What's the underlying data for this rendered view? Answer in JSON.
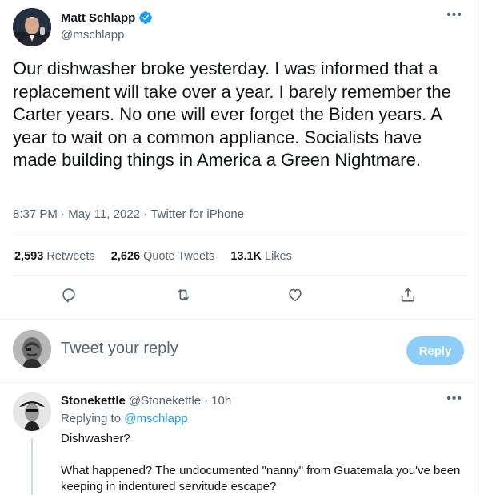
{
  "tweet": {
    "author": {
      "name": "Matt Schlapp",
      "handle": "@mschlapp",
      "verified": true,
      "avatar_icon": "person-photo"
    },
    "text": "Our dishwasher broke yesterday. I was informed that a replacement will take over a year. I barely remember the Carter years. No one will ever forget the Biden years. A year to wait on a common appliance. Socialists have made building things in America a Green Nightmare.",
    "time": "8:37 PM",
    "date": "May 11, 2022",
    "source": "Twitter for iPhone",
    "stats": [
      {
        "value": "2,593",
        "label": "Retweets"
      },
      {
        "value": "2,626",
        "label": "Quote Tweets"
      },
      {
        "value": "13.1K",
        "label": "Likes"
      }
    ],
    "actions": [
      "reply-icon",
      "retweet-icon",
      "like-icon",
      "share-icon"
    ]
  },
  "composer": {
    "placeholder": "Tweet your reply",
    "button_label": "Reply"
  },
  "reply": {
    "name": "Stonekettle",
    "handle": "@Stonekettle",
    "dot": "·",
    "time": "10h",
    "replying_prefix": "Replying to ",
    "replying_to": "@mschlapp",
    "paragraphs": [
      "Dishwasher?",
      "What happened? The undocumented \"nanny\" from Guatemala you've been keeping in indentured servitude escape?"
    ]
  },
  "colors": {
    "accent": "#1d9bf0",
    "muted": "#536471",
    "reply_button_disabled": "#8ecdf8"
  }
}
